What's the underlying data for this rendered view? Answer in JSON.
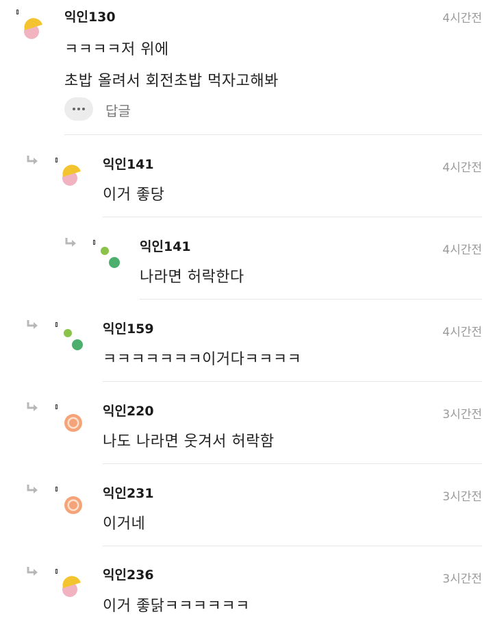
{
  "comments": [
    {
      "author": "익인130",
      "time": "4시간전",
      "lines": [
        "ㅋㅋㅋㅋ저 위에",
        "초밥 올려서 회전초밥 먹자고해봐"
      ],
      "avatar": "yellow-pink-icon",
      "reply_label": "답글"
    },
    {
      "author": "익인141",
      "time": "4시간전",
      "lines": [
        "이거 좋당"
      ],
      "avatar": "yellow-pink-icon"
    },
    {
      "author": "익인141",
      "time": "4시간전",
      "lines": [
        "나라면 허락한다"
      ],
      "avatar": "green-dots-icon"
    },
    {
      "author": "익인159",
      "time": "4시간전",
      "lines": [
        "ㅋㅋㅋㅋㅋㅋㅋ이거다ㅋㅋㅋㅋ"
      ],
      "avatar": "green-dots-icon"
    },
    {
      "author": "익인220",
      "time": "3시간전",
      "lines": [
        "나도 나라면 웃겨서 허락함"
      ],
      "avatar": "orange-ring-icon"
    },
    {
      "author": "익인231",
      "time": "3시간전",
      "lines": [
        "이거네"
      ],
      "avatar": "orange-ring-icon"
    },
    {
      "author": "익인236",
      "time": "3시간전",
      "lines": [
        "이거 좋닭ㅋㅋㅋㅋㅋㅋ"
      ],
      "avatar": "yellow-pink-icon"
    }
  ],
  "colors": {
    "yellow": "#f4c430",
    "pink": "#f2b3c0",
    "green_light": "#8bc34a",
    "green_dark": "#4caf6e",
    "orange": "#f5a47a"
  }
}
